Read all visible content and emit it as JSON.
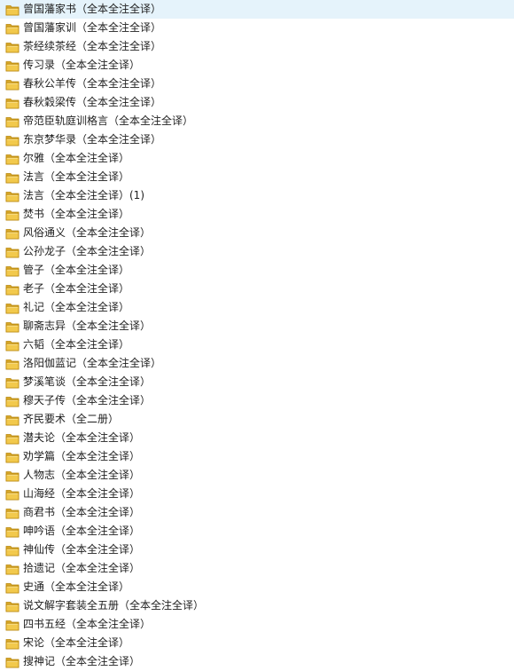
{
  "folders": [
    {
      "name": "曾国藩家书（全本全注全译）",
      "icon": "folder-icon"
    },
    {
      "name": "曾国藩家训（全本全注全译）",
      "icon": "folder-icon"
    },
    {
      "name": "茶经续茶经（全本全注全译）",
      "icon": "folder-icon"
    },
    {
      "name": "传习录（全本全注全译）",
      "icon": "folder-icon"
    },
    {
      "name": "春秋公羊传（全本全注全译）",
      "icon": "folder-icon"
    },
    {
      "name": "春秋穀梁传（全本全注全译）",
      "icon": "folder-icon"
    },
    {
      "name": "帝范臣轨庭训格言（全本全注全译）",
      "icon": "folder-icon"
    },
    {
      "name": "东京梦华录（全本全注全译）",
      "icon": "folder-icon"
    },
    {
      "name": "尔雅（全本全注全译）",
      "icon": "folder-icon"
    },
    {
      "name": "法言（全本全注全译）",
      "icon": "folder-icon"
    },
    {
      "name": "法言（全本全注全译）(1)",
      "icon": "folder-icon"
    },
    {
      "name": "焚书（全本全注全译）",
      "icon": "folder-icon"
    },
    {
      "name": "风俗通义（全本全注全译）",
      "icon": "folder-icon"
    },
    {
      "name": "公孙龙子（全本全注全译）",
      "icon": "folder-icon"
    },
    {
      "name": "管子（全本全注全译）",
      "icon": "folder-icon"
    },
    {
      "name": "老子（全本全注全译）",
      "icon": "folder-icon"
    },
    {
      "name": "礼记（全本全注全译）",
      "icon": "folder-icon"
    },
    {
      "name": "聊斋志异（全本全注全译）",
      "icon": "folder-icon"
    },
    {
      "name": "六韬（全本全注全译）",
      "icon": "folder-icon"
    },
    {
      "name": "洛阳伽蓝记（全本全注全译）",
      "icon": "folder-icon"
    },
    {
      "name": "梦溪笔谈（全本全注全译）",
      "icon": "folder-icon"
    },
    {
      "name": "穆天子传（全本全注全译）",
      "icon": "folder-icon"
    },
    {
      "name": "齐民要术（全二册）",
      "icon": "folder-icon"
    },
    {
      "name": "潜夫论（全本全注全译）",
      "icon": "folder-icon"
    },
    {
      "name": "劝学篇（全本全注全译）",
      "icon": "folder-icon"
    },
    {
      "name": "人物志（全本全注全译）",
      "icon": "folder-icon"
    },
    {
      "name": "山海经（全本全注全译）",
      "icon": "folder-icon"
    },
    {
      "name": "商君书（全本全注全译）",
      "icon": "folder-icon"
    },
    {
      "name": "呻吟语（全本全注全译）",
      "icon": "folder-icon"
    },
    {
      "name": "神仙传（全本全注全译）",
      "icon": "folder-icon"
    },
    {
      "name": "拾遗记（全本全注全译）",
      "icon": "folder-icon"
    },
    {
      "name": "史通（全本全注全译）",
      "icon": "folder-icon"
    },
    {
      "name": "说文解字套装全五册（全本全注全译）",
      "icon": "folder-icon"
    },
    {
      "name": "四书五经（全本全注全译）",
      "icon": "folder-icon"
    },
    {
      "name": "宋论（全本全注全译）",
      "icon": "folder-icon"
    },
    {
      "name": "搜神记（全本全注全译）",
      "icon": "folder-icon"
    }
  ],
  "colors": {
    "folder_front": "#f2c94c",
    "folder_back": "#d9a82b",
    "folder_edge": "#b8860b",
    "text": "#1e1e1e"
  }
}
